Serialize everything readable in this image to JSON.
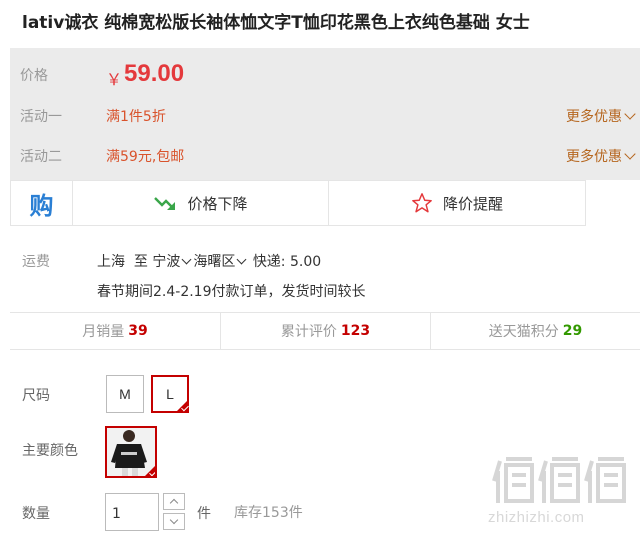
{
  "product": {
    "title": "lativ诚衣 纯棉宽松版长袖体恤文字T恤印花黑色上衣纯色基础 女士"
  },
  "price": {
    "label": "价格",
    "symbol": "￥",
    "value": "59.00",
    "color": "#e4393c"
  },
  "promotions": [
    {
      "label": "活动一",
      "text": "满1件5折",
      "more": "更多优惠"
    },
    {
      "label": "活动二",
      "text": "满59元,包邮",
      "more": "更多优惠"
    }
  ],
  "actions": {
    "buy_icon": "购",
    "price_drop": "价格下降",
    "price_alert": "降价提醒"
  },
  "shipping": {
    "label": "运费",
    "from": "上海",
    "to_word": "至",
    "city": "宁波",
    "district": "海曙区",
    "express": "快递: 5.00",
    "notice": "春节期间2.4-2.19付款订单，发货时间较长"
  },
  "stats": [
    {
      "label": "月销量",
      "value": "39",
      "color": "#c40000"
    },
    {
      "label": "累计评价",
      "value": "123",
      "color": "#c40000"
    },
    {
      "label": "送天猫积分",
      "value": "29",
      "color": "#339900"
    }
  ],
  "options": {
    "size_label": "尺码",
    "sizes": [
      "M",
      "L"
    ],
    "selected_size": "L",
    "color_label": "主要颜色",
    "qty_label": "数量",
    "qty_value": "1",
    "unit": "件",
    "stock": "库存153件"
  },
  "watermark": {
    "logo": "值值值",
    "text": "zhizhizhi.com"
  }
}
